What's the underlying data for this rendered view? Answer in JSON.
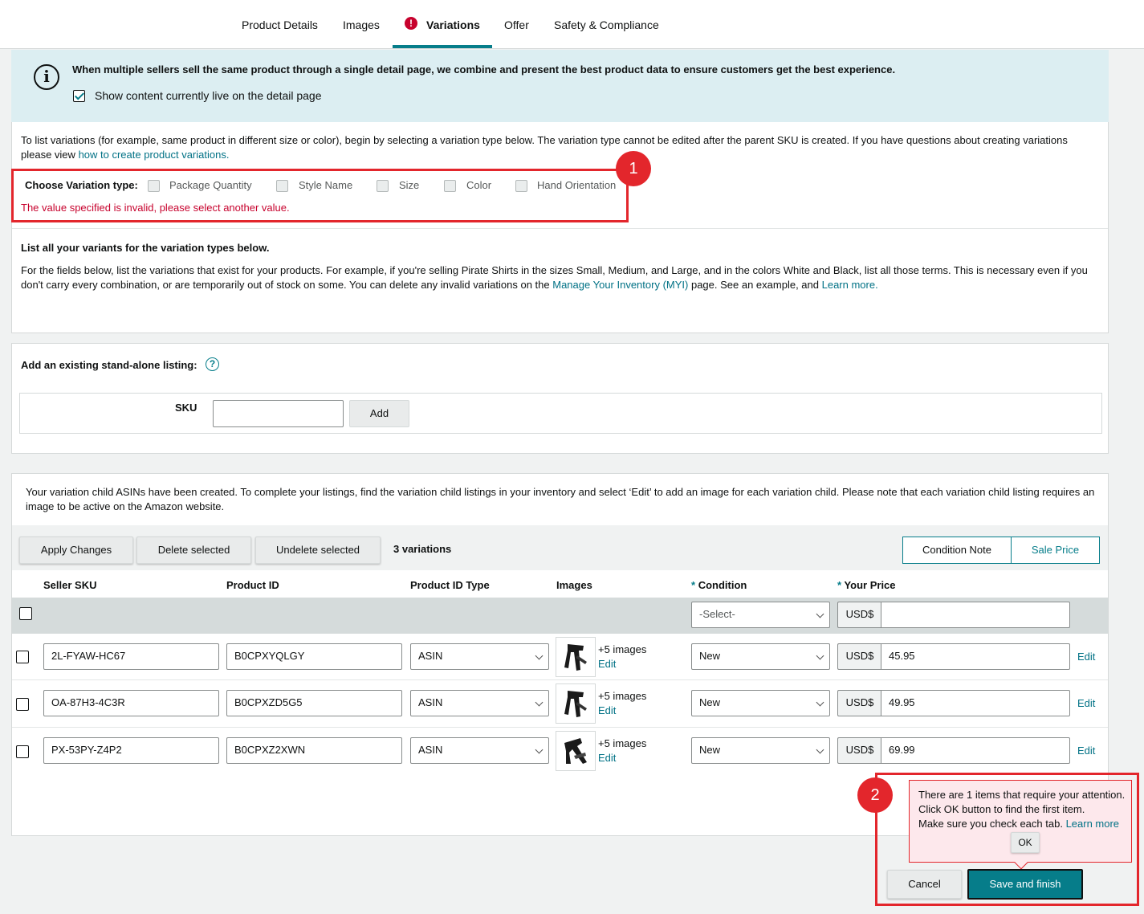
{
  "tabs": [
    "Product Details",
    "Images",
    "Variations",
    "Offer",
    "Safety & Compliance"
  ],
  "tab_alert_symbol": "!",
  "banner": {
    "text": "When multiple sellers sell the same product through a single detail page, we combine and present the best product data to ensure customers get the best experience.",
    "checkbox_label": "Show content currently live on the detail page"
  },
  "variation": {
    "intro_line1": "To list variations (for example, same product in different size or color), begin by selecting a variation type below. The variation type cannot be edited after the parent SKU is created. If you have questions about creating variations",
    "intro_line2_prefix": "please view",
    "intro_link": "how to create product variations.",
    "choose_label": "Choose Variation type:",
    "types": [
      "Package Quantity",
      "Style Name",
      "Size",
      "Color",
      "Hand Orientation"
    ],
    "error": "The value specified is invalid, please select another value.",
    "list_heading": "List all your variants for the variation types below.",
    "list_line1": "For the fields below, list the variations that exist for your products. For example, if you're selling Pirate Shirts in the sizes Small, Medium, and Large, and in the colors White and Black, list all those terms. This is necessary even if you",
    "list_line2_a": "don't carry every combination, or are temporarily out of stock on some. You can delete any invalid variations on the",
    "list_link_myi": "Manage Your Inventory (MYI)",
    "list_line2_b": "page. See an example, and",
    "list_link_learn": "Learn more."
  },
  "badges": [
    "1",
    "2"
  ],
  "standalone": {
    "heading": "Add an existing stand-alone listing:",
    "help_symbol": "?",
    "sku_label": "SKU",
    "sku_value": "",
    "add_label": "Add"
  },
  "children": {
    "notice_line1": "Your variation child ASINs have been created. To complete your listings, find the variation child listings in your inventory and select ‘Edit’ to add an image for each variation child. Please note that each variation child listing requires an",
    "notice_line2": "image to be active on the Amazon website.",
    "buttons": {
      "apply": "Apply Changes",
      "delete": "Delete selected",
      "undelete": "Undelete selected"
    },
    "count_label": "3 variations",
    "condition_note": "Condition Note",
    "sale_price": "Sale Price",
    "columns": {
      "sku": "Seller SKU",
      "product_id": "Product ID",
      "id_type": "Product ID Type",
      "images": "Images",
      "condition": "Condition",
      "price": "Your Price",
      "required_mark": "*"
    },
    "bulk": {
      "condition_placeholder": "-Select-",
      "currency": "USD$",
      "price": ""
    },
    "rows": [
      {
        "sku": "2L-FYAW-HC67",
        "product_id": "B0CPXYQLGY",
        "id_type": "ASIN",
        "images": "+5 images",
        "edit_images": "Edit",
        "condition": "New",
        "currency": "USD$",
        "price": "45.95",
        "edit": "Edit"
      },
      {
        "sku": "OA-87H3-4C3R",
        "product_id": "B0CPXZD5G5",
        "id_type": "ASIN",
        "images": "+5 images",
        "edit_images": "Edit",
        "condition": "New",
        "currency": "USD$",
        "price": "49.95",
        "edit": "Edit"
      },
      {
        "sku": "PX-53PY-Z4P2",
        "product_id": "B0CPXZ2XWN",
        "id_type": "ASIN",
        "images": "+5 images",
        "edit_images": "Edit",
        "condition": "New",
        "currency": "USD$",
        "price": "69.99",
        "edit": "Edit"
      }
    ]
  },
  "popover": {
    "line1": "There are 1 items that require your attention.",
    "line2": "Click OK button to find the first item.",
    "line3": "Make sure you check each tab.",
    "learn_more": "Learn more",
    "ok": "OK"
  },
  "footer": {
    "cancel": "Cancel",
    "save": "Save and finish"
  },
  "colors": {
    "accent": "#067d8a",
    "error": "#c7022d",
    "highlight": "#e3262c",
    "banner": "#dceef2"
  }
}
